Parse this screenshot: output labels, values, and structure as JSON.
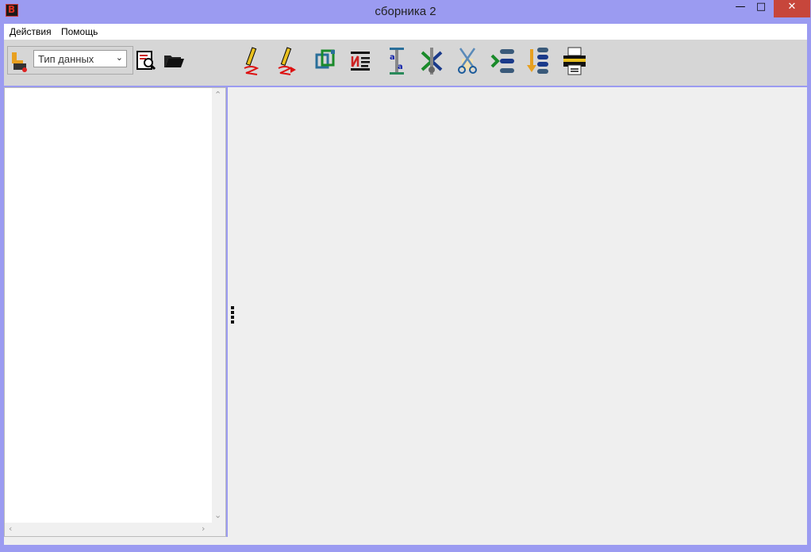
{
  "window": {
    "title": "сборника 2",
    "app_icon_letter": "B",
    "controls": {
      "minimize": "—",
      "maximize": "□",
      "close": "✕"
    }
  },
  "menu": {
    "items": [
      "Действия",
      "Помощь"
    ]
  },
  "toolbar": {
    "left_icon": "download-to-disk-icon",
    "data_type_select": {
      "value": "Тип данных"
    },
    "buttons": [
      "find-document-icon",
      "open-folder-icon",
      "edit-pencil-icon",
      "edit-pencil-arrow-icon",
      "copy-frames-icon",
      "text-edit-icon",
      "text-replace-icon",
      "merge-arrows-icon",
      "cut-scissors-icon",
      "list-insert-icon",
      "list-move-down-icon",
      "print-icon"
    ]
  },
  "colors": {
    "titlebar": "#9b9bf1",
    "close_button": "#c7463b",
    "toolbar": "#d6d6d6",
    "main_area": "#efefef"
  }
}
